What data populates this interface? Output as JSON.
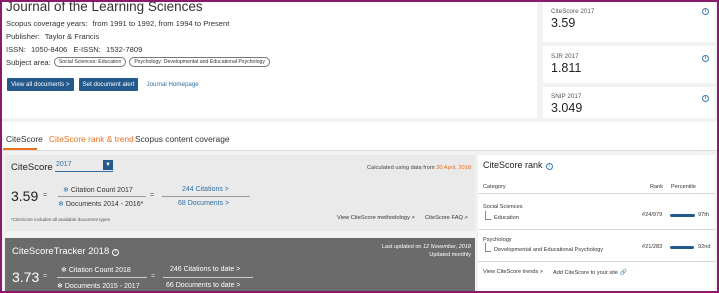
{
  "journal": {
    "title": "Journal of the Learning Sciences",
    "coverage_label": "Scopus coverage years:",
    "coverage_value": "from 1991 to 1992, from 1994 to Present",
    "publisher_label": "Publisher:",
    "publisher_value": "Taylor & Francis",
    "issn_label": "ISSN:",
    "issn_value": "1050-8406",
    "eissn_label": "E-ISSN:",
    "eissn_value": "1532-7809",
    "subject_label": "Subject area:",
    "subjects": [
      "Social Sciences: Education",
      "Psychology: Developmental and Educational Psychology"
    ]
  },
  "actions": {
    "view_all": "View all documents >",
    "alert": "Set document alert",
    "homepage": "Journal Homepage"
  },
  "metrics": [
    {
      "label": "CiteScore 2017",
      "value": "3.59"
    },
    {
      "label": "SJR 2017",
      "value": "1.811"
    },
    {
      "label": "SNIP 2017",
      "value": "3.049"
    }
  ],
  "tabs": [
    "CiteScore",
    "CiteScore rank & trend",
    "Scopus content coverage"
  ],
  "citescore": {
    "title": "CiteScore",
    "year": "2017",
    "calc_prefix": "Calculated using data from",
    "calc_date": "30 April, 2018",
    "value": "3.59",
    "eq": "=",
    "citation_label": "Citation Count 2017",
    "documents_label": "Documents 2014 - 2016*",
    "citations_link": "244 Citations >",
    "documents_link": "68 Documents >",
    "footnote": "*CiteScore includes all available document types",
    "methodology": "View CiteScore methodology >",
    "faq": "CiteScore FAQ >"
  },
  "tracker": {
    "title": "CiteScoreTracker 2018",
    "updated_prefix": "Last updated on",
    "updated_date": "12 November, 2018",
    "updated_freq": "Updated monthly",
    "value": "3.73",
    "eq": "=",
    "citation_label": "Citation Count 2018",
    "documents_label": "Documents 2015 - 2017",
    "citations_link": "246 Citations to date >",
    "documents_link": "66 Documents to date >"
  },
  "rank": {
    "title": "CiteScore rank",
    "col_category": "Category",
    "col_rank": "Rank",
    "col_percentile": "Percentile",
    "rows": [
      {
        "category": "Social Sciences",
        "sub": "Education",
        "rank": "#24/979",
        "percentile": "97th",
        "pct_value": 97
      },
      {
        "category": "Psychology",
        "sub": "Developmental and Educational Psychology",
        "rank": "#21/283",
        "percentile": "92nd",
        "pct_value": 92
      }
    ],
    "view_trends": "View CiteScore trends >",
    "add_to_site": "Add CiteScore to your site"
  }
}
